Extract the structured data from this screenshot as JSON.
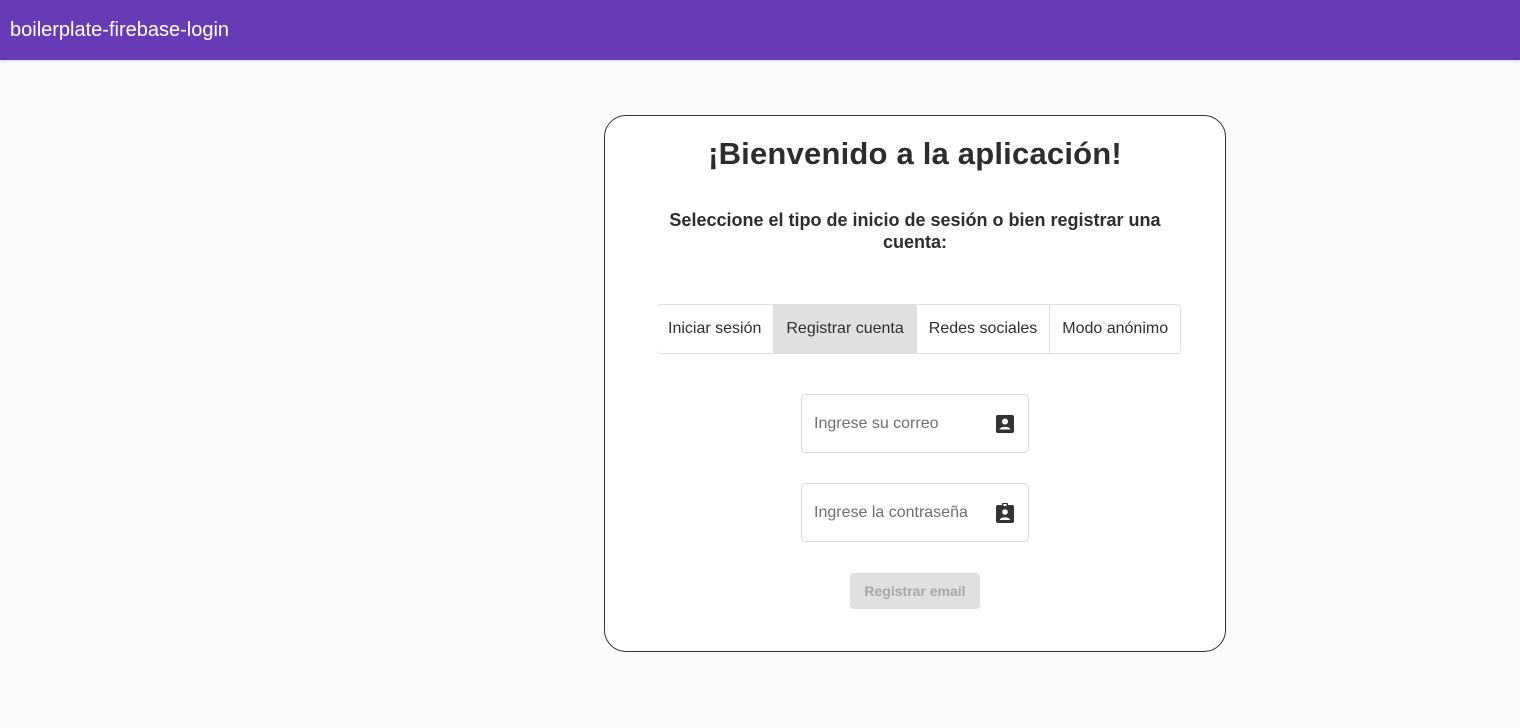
{
  "app": {
    "title": "boilerplate-firebase-login",
    "accent_color": "#673ab7"
  },
  "card": {
    "title": "¡Bienvenido a la aplicación!",
    "subtitle": "Seleccione el tipo de inicio de sesión o bien registrar una cuenta:"
  },
  "auth_modes": {
    "selected": "Registrar cuenta",
    "options": [
      {
        "label": "Iniciar sesión"
      },
      {
        "label": "Registrar cuenta"
      },
      {
        "label": "Redes sociales"
      },
      {
        "label": "Modo anónimo"
      }
    ]
  },
  "form": {
    "email": {
      "value": "",
      "placeholder": "Ingrese su correo",
      "icon": "account-box-icon"
    },
    "password": {
      "value": "",
      "placeholder": "Ingrese la contraseña",
      "icon": "assignment-ind-icon"
    },
    "submit_label": "Registrar email",
    "submit_disabled": true
  }
}
